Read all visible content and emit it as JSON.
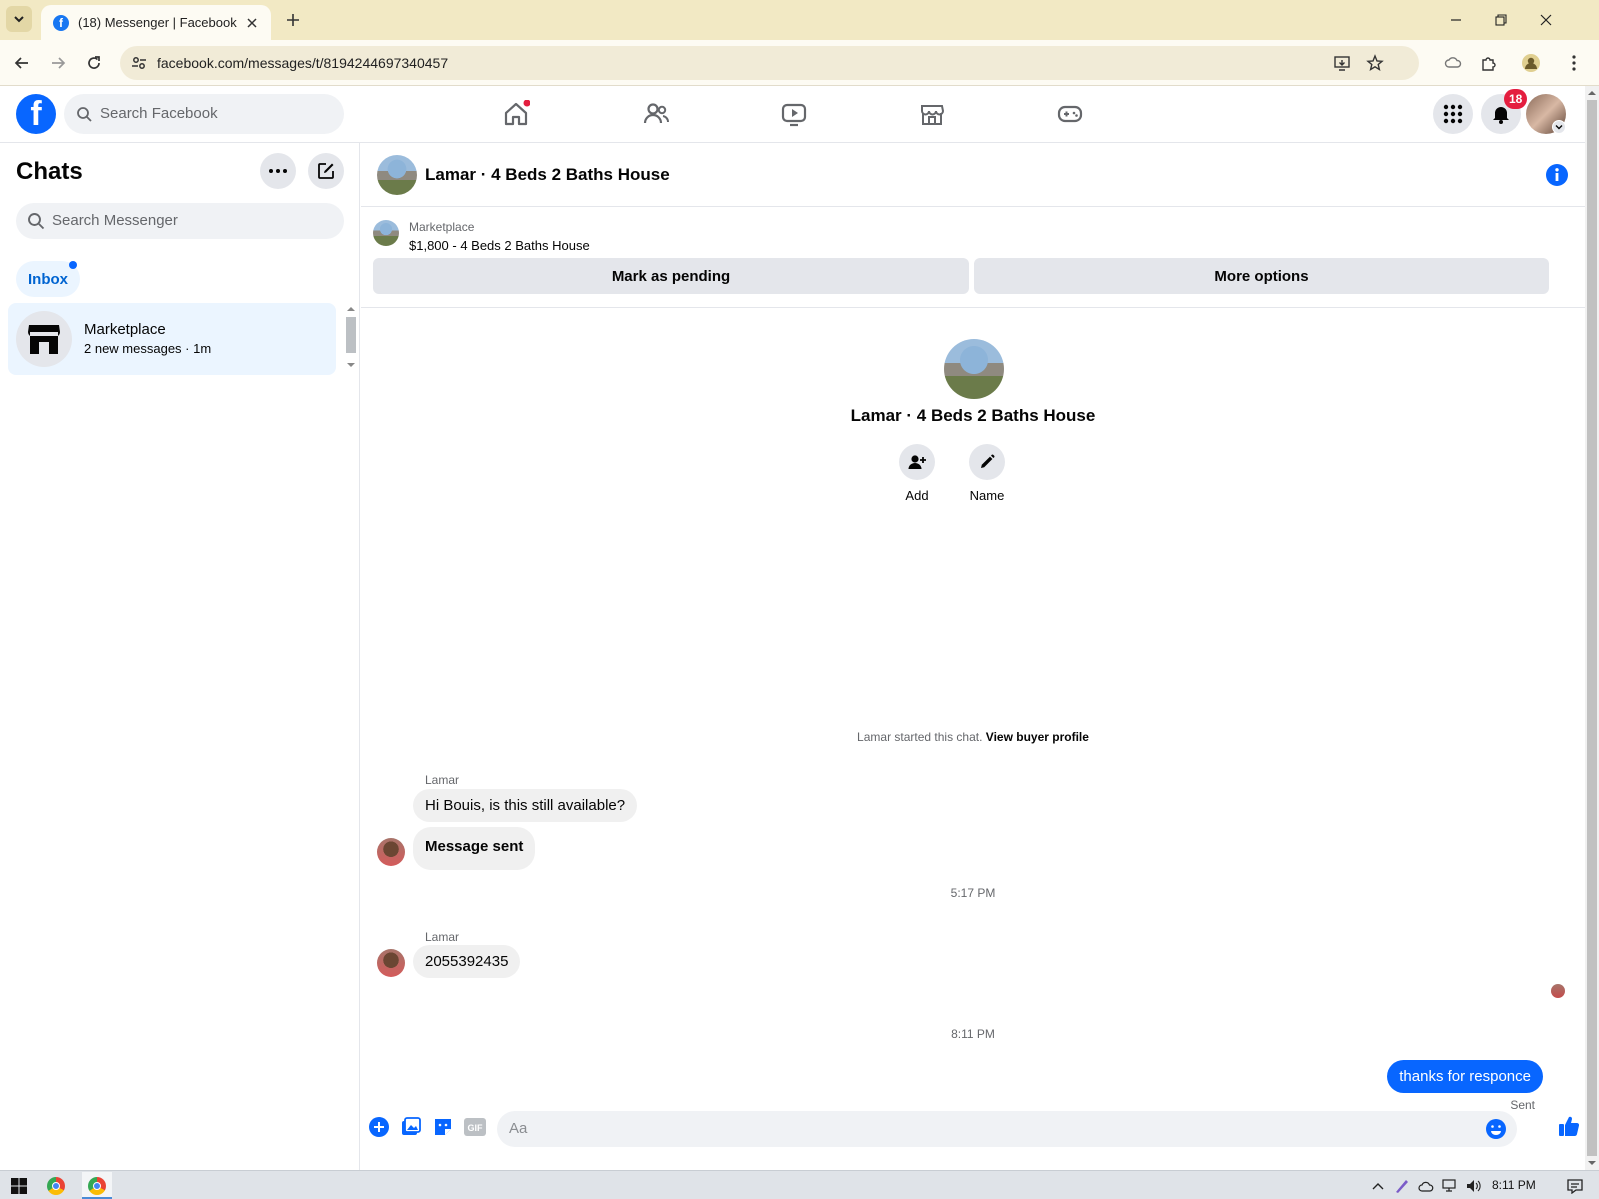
{
  "browser": {
    "tab_title": "(18) Messenger | Facebook",
    "url": "facebook.com/messages/t/8194244697340457"
  },
  "fb": {
    "search_placeholder": "Search Facebook",
    "notification_count": "18",
    "brand_color": "#0866ff"
  },
  "sidebar": {
    "title": "Chats",
    "search_placeholder": "Search Messenger",
    "inbox_label": "Inbox",
    "chats": [
      {
        "name": "Marketplace",
        "preview": "2 new messages · 1m"
      }
    ]
  },
  "conversation": {
    "title": "Lamar · 4 Beds 2 Baths House",
    "listing": {
      "label": "Marketplace",
      "price_title": "$1,800 - 4 Beds 2 Baths House",
      "pending_button": "Mark as pending",
      "more_button": "More options"
    },
    "profile": {
      "name": "Lamar · 4 Beds 2 Baths House",
      "add_label": "Add",
      "name_label": "Name"
    },
    "started_text": "Lamar started this chat. ",
    "view_profile_link": "View buyer profile",
    "messages": [
      {
        "sender": "Lamar",
        "text": "Hi Bouis, is this still available?"
      },
      {
        "text": "Message sent"
      },
      {
        "time": "5:17 PM"
      },
      {
        "sender": "Lamar",
        "text": "2055392435"
      },
      {
        "time": "8:11 PM"
      },
      {
        "text": "thanks for responce",
        "status": "Sent"
      }
    ],
    "composer_placeholder": "Aa"
  },
  "taskbar": {
    "clock": "8:11 PM"
  }
}
